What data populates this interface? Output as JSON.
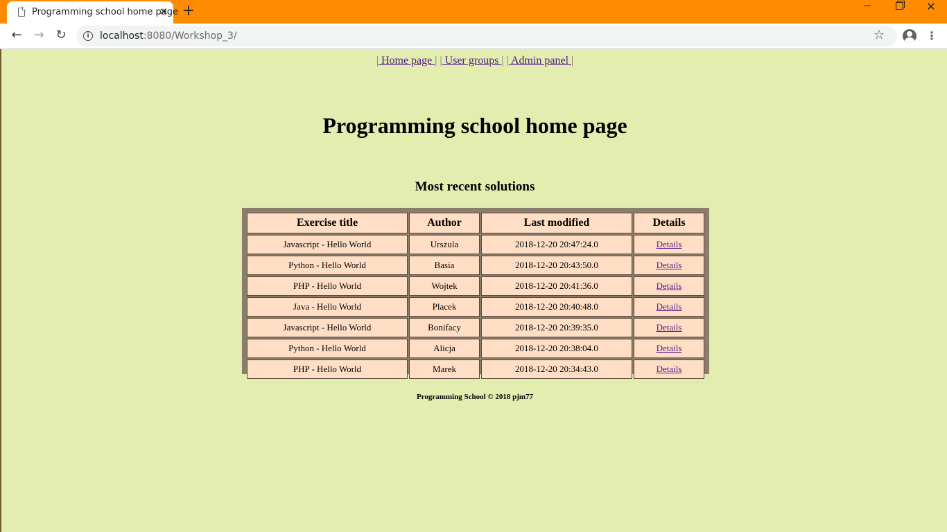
{
  "browser": {
    "tab_title": "Programming school home page",
    "tab_close": "✕",
    "new_tab": "+",
    "url_host": "localhost",
    "url_rest": ":8080/Workshop_3/",
    "accent_color": "#ff8c00"
  },
  "nav": {
    "separator": "|",
    "items": [
      {
        "label": " Home page "
      },
      {
        "label": " User groups "
      },
      {
        "label": " Admin panel "
      }
    ]
  },
  "page_title": "Programming school home page",
  "section_title": "Most recent solutions",
  "table": {
    "headers": [
      "Exercise title",
      "Author",
      "Last modified",
      "Details"
    ],
    "rows": [
      {
        "title": "Javascript - Hello World",
        "author": "Urszula",
        "modified": "2018-12-20 20:47:24.0",
        "details": "Details"
      },
      {
        "title": "Python - Hello World",
        "author": "Basia",
        "modified": "2018-12-20 20:43:50.0",
        "details": "Details"
      },
      {
        "title": "PHP - Hello World",
        "author": "Wojtek",
        "modified": "2018-12-20 20:41:36.0",
        "details": "Details"
      },
      {
        "title": "Java - Hello World",
        "author": "Placek",
        "modified": "2018-12-20 20:40:48.0",
        "details": "Details"
      },
      {
        "title": "Javascript - Hello World",
        "author": "Bonifacy",
        "modified": "2018-12-20 20:39:35.0",
        "details": "Details"
      },
      {
        "title": "Python - Hello World",
        "author": "Alicja",
        "modified": "2018-12-20 20:38:04.0",
        "details": "Details"
      },
      {
        "title": "PHP - Hello World",
        "author": "Marek",
        "modified": "2018-12-20 20:34:43.0",
        "details": "Details"
      }
    ]
  },
  "footer": "Programming School © 2018 pjm77",
  "colors": {
    "page_background": "#e3edb0",
    "table_frame": "#8b7d6b",
    "cell_background": "#ffdec5"
  }
}
